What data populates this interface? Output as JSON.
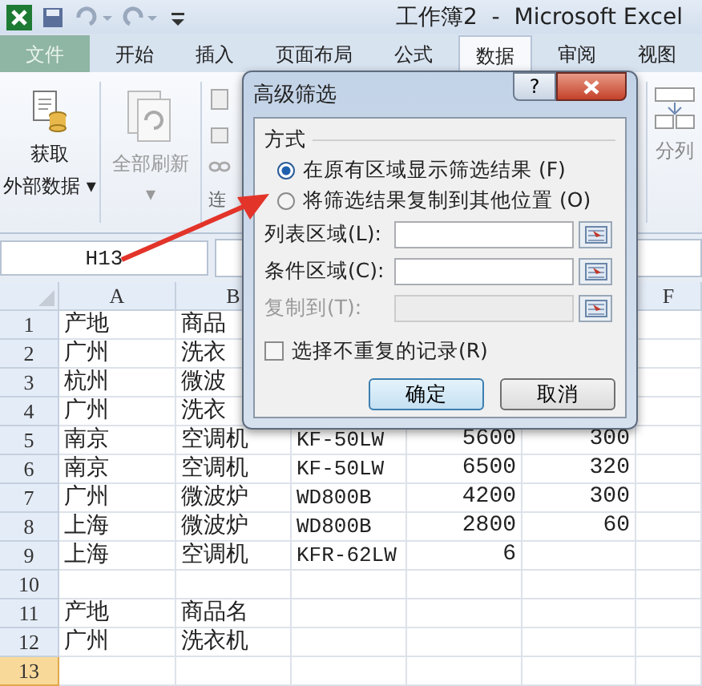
{
  "window": {
    "title": "工作簿2  -  Microsoft Excel"
  },
  "tabs": [
    {
      "label": "文件",
      "kind": "file",
      "selected": false
    },
    {
      "label": "开始",
      "kind": "tab",
      "selected": false
    },
    {
      "label": "插入",
      "kind": "tab",
      "selected": false
    },
    {
      "label": "页面布局",
      "kind": "tab",
      "selected": false
    },
    {
      "label": "公式",
      "kind": "tab",
      "selected": false
    },
    {
      "label": "数据",
      "kind": "tab",
      "selected": true
    },
    {
      "label": "审阅",
      "kind": "tab",
      "selected": false
    },
    {
      "label": "视图",
      "kind": "tab",
      "selected": false
    }
  ],
  "ribbon": {
    "buttons": [
      {
        "lines": [
          "获取",
          "外部数据 ▾"
        ],
        "disabled": false
      },
      {
        "lines": [
          "全部刷新",
          "▾"
        ],
        "disabled": true
      }
    ],
    "group_label": "连",
    "right_button": "分列"
  },
  "name_box": "H13",
  "sheet": {
    "columns": [
      "A",
      "B",
      "",
      "",
      "",
      "F"
    ],
    "rows": [
      {
        "header": "1",
        "selected": false,
        "cells": [
          "产地",
          "商品",
          "",
          "",
          "",
          ""
        ]
      },
      {
        "header": "2",
        "selected": false,
        "cells": [
          "广州",
          "洗衣",
          "",
          "",
          "",
          ""
        ]
      },
      {
        "header": "3",
        "selected": false,
        "cells": [
          "杭州",
          "微波",
          "",
          "",
          "",
          ""
        ]
      },
      {
        "header": "4",
        "selected": false,
        "cells": [
          "广州",
          "洗衣",
          "",
          "",
          "",
          ""
        ]
      },
      {
        "header": "5",
        "selected": false,
        "cells": [
          "南京",
          "空调机",
          "KF-50LW",
          "5600",
          "300",
          ""
        ]
      },
      {
        "header": "6",
        "selected": false,
        "cells": [
          "南京",
          "空调机",
          "KF-50LW",
          "6500",
          "320",
          ""
        ]
      },
      {
        "header": "7",
        "selected": false,
        "cells": [
          "广州",
          "微波炉",
          "WD800B",
          "4200",
          "300",
          ""
        ]
      },
      {
        "header": "8",
        "selected": false,
        "cells": [
          "上海",
          "微波炉",
          "WD800B",
          "2800",
          "60",
          ""
        ]
      },
      {
        "header": "9",
        "selected": false,
        "cells": [
          "上海",
          "空调机",
          "KFR-62LW",
          "6",
          "",
          ""
        ]
      },
      {
        "header": "10",
        "selected": false,
        "cells": [
          "",
          "",
          "",
          "",
          "",
          ""
        ]
      },
      {
        "header": "11",
        "selected": false,
        "cells": [
          "产地",
          "商品名",
          "",
          "",
          "",
          ""
        ]
      },
      {
        "header": "12",
        "selected": false,
        "cells": [
          "广州",
          "洗衣机",
          "",
          "",
          "",
          ""
        ]
      },
      {
        "header": "13",
        "selected": true,
        "cells": [
          "",
          "",
          "",
          "",
          "",
          ""
        ]
      }
    ]
  },
  "dialog": {
    "title": "高级筛选",
    "help_button": "?",
    "group_label": "方式",
    "options": [
      {
        "label": "在原有区域显示筛选结果 (F)",
        "selected": true
      },
      {
        "label": "将筛选结果复制到其他位置 (O)",
        "selected": false
      }
    ],
    "fields": [
      {
        "label": "列表区域(L):",
        "disabled": false
      },
      {
        "label": "条件区域(C):",
        "disabled": false
      },
      {
        "label": "复制到(T):",
        "disabled": true
      }
    ],
    "checkbox": {
      "label": "选择不重复的记录(R)",
      "checked": false
    },
    "buttons": [
      {
        "label": "确定",
        "default": true
      },
      {
        "label": "取消",
        "default": false
      }
    ]
  }
}
